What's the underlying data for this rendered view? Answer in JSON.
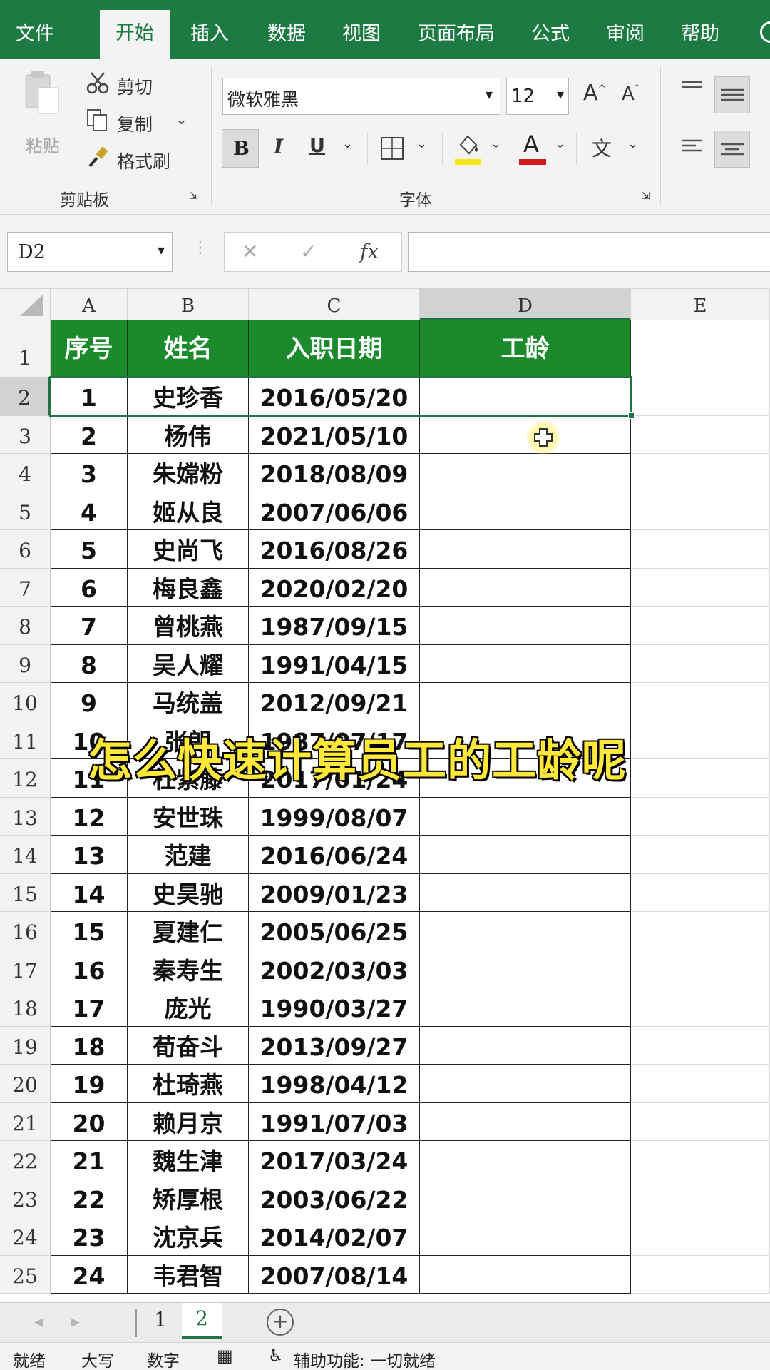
{
  "tabs": [
    "文件",
    "开始",
    "插入",
    "数据",
    "视图",
    "页面布局",
    "公式",
    "审阅",
    "帮助"
  ],
  "active_tab": "开始",
  "ribbon": {
    "clipboard": {
      "paste": "粘贴",
      "cut": "剪切",
      "copy": "复制",
      "format_painter": "格式刷",
      "group_label": "剪贴板"
    },
    "font": {
      "name": "微软雅黑",
      "size": "12",
      "bold": "B",
      "italic": "I",
      "underline": "U",
      "grow": "A",
      "shrink": "A",
      "font_color_letter": "A",
      "phonetic": "文",
      "group_label": "字体"
    },
    "colors": {
      "fill_swatch": "#f5e619",
      "font_swatch": "#d11a1a"
    }
  },
  "formula_bar": {
    "name_box": "D2",
    "cancel": "✕",
    "confirm": "✓",
    "fx": "fx",
    "value": ""
  },
  "columns": [
    "A",
    "B",
    "C",
    "D",
    "E"
  ],
  "selected_cell": "D2",
  "header": [
    "序号",
    "姓名",
    "入职日期",
    "工龄"
  ],
  "rows": [
    [
      "1",
      "史珍香",
      "2016/05/20",
      ""
    ],
    [
      "2",
      "杨伟",
      "2021/05/10",
      ""
    ],
    [
      "3",
      "朱嫦粉",
      "2018/08/09",
      ""
    ],
    [
      "4",
      "姬从良",
      "2007/06/06",
      ""
    ],
    [
      "5",
      "史尚飞",
      "2016/08/26",
      ""
    ],
    [
      "6",
      "梅良鑫",
      "2020/02/20",
      ""
    ],
    [
      "7",
      "曾桃燕",
      "1987/09/15",
      ""
    ],
    [
      "8",
      "吴人耀",
      "1991/04/15",
      ""
    ],
    [
      "9",
      "马统盖",
      "2012/09/21",
      ""
    ],
    [
      "10",
      "张朗",
      "1987/07/17",
      ""
    ],
    [
      "11",
      "杜紫藤",
      "2017/01/24",
      ""
    ],
    [
      "12",
      "安世珠",
      "1999/08/07",
      ""
    ],
    [
      "13",
      "范建",
      "2016/06/24",
      ""
    ],
    [
      "14",
      "史昊驰",
      "2009/01/23",
      ""
    ],
    [
      "15",
      "夏建仁",
      "2005/06/25",
      ""
    ],
    [
      "16",
      "秦寿生",
      "2002/03/03",
      ""
    ],
    [
      "17",
      "庞光",
      "1990/03/27",
      ""
    ],
    [
      "18",
      "荀奋斗",
      "2013/09/27",
      ""
    ],
    [
      "19",
      "杜琦燕",
      "1998/04/12",
      ""
    ],
    [
      "20",
      "赖月京",
      "1991/07/03",
      ""
    ],
    [
      "21",
      "魏生津",
      "2017/03/24",
      ""
    ],
    [
      "22",
      "矫厚根",
      "2003/06/22",
      ""
    ],
    [
      "23",
      "沈京兵",
      "2014/02/07",
      ""
    ],
    [
      "24",
      "韦君智",
      "2007/08/14",
      ""
    ]
  ],
  "row_numbers": [
    "1",
    "2",
    "3",
    "4",
    "5",
    "6",
    "7",
    "8",
    "9",
    "10",
    "11",
    "12",
    "13",
    "14",
    "15",
    "16",
    "17",
    "18",
    "19",
    "20",
    "21",
    "22",
    "23",
    "24",
    "25"
  ],
  "caption": "怎么快速计算员工的工龄呢",
  "sheets": [
    "1",
    "2"
  ],
  "active_sheet": "2",
  "status": {
    "ready": "就绪",
    "caps": "大写",
    "num": "数字",
    "accessibility": "辅助功能: 一切就绪"
  },
  "accent_color": "#1d7a43",
  "header_fill": "#1b8a2c"
}
